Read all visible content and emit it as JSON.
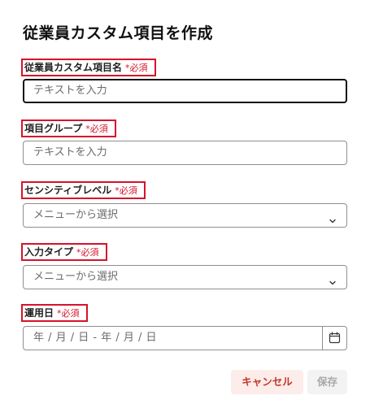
{
  "dialog": {
    "title": "従業員カスタム項目を作成"
  },
  "fields": [
    {
      "label": "従業員カスタム項目名",
      "required_marker": "*必須",
      "placeholder": "テキストを入力",
      "type": "text"
    },
    {
      "label": "項目グループ",
      "required_marker": "*必須",
      "placeholder": "テキストを入力",
      "type": "text"
    },
    {
      "label": "センシティブレベル",
      "required_marker": "*必須",
      "placeholder": "メニューから選択",
      "type": "select"
    },
    {
      "label": "入力タイプ",
      "required_marker": "*必須",
      "placeholder": "メニューから選択",
      "type": "select"
    },
    {
      "label": "運用日",
      "required_marker": "*必須",
      "placeholder": "年 / 月 / 日 - 年 / 月 / 日",
      "type": "date-range"
    }
  ],
  "icons": {
    "select": "chevron-down-icon",
    "date": "calendar-icon"
  },
  "footer": {
    "cancel_label": "キャンセル",
    "save_label": "保存"
  },
  "colors": {
    "required": "#d6132a",
    "annotation_box": "#d6132a",
    "cancel_bg": "#fcecea",
    "cancel_text": "#c0392b",
    "save_bg": "#f3f3f3",
    "save_text": "#a8a8a8"
  }
}
